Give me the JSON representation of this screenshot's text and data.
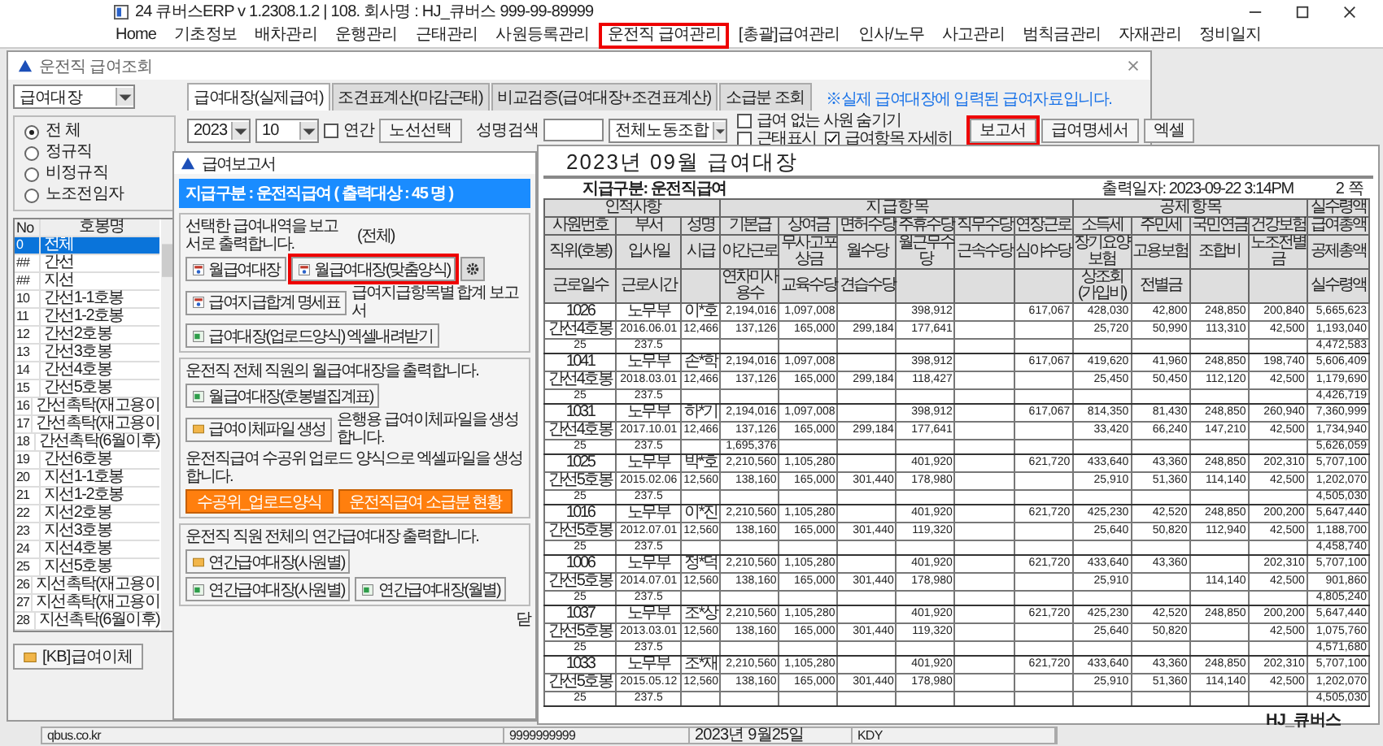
{
  "app_window": {
    "title": "24 큐버스ERP v 1.2308.1.2  | 108. 회사명 : HJ_큐버스  999-99-89999",
    "menu": [
      {
        "label": "Home",
        "highlighted": false
      },
      {
        "label": "기초정보",
        "highlighted": false
      },
      {
        "label": "배차관리",
        "highlighted": false
      },
      {
        "label": "운행관리",
        "highlighted": false
      },
      {
        "label": "근태관리",
        "highlighted": false
      },
      {
        "label": "사원등록관리",
        "highlighted": false
      },
      {
        "label": "운전직 급여관리",
        "highlighted": true
      },
      {
        "label": "[총괄]급여관리",
        "highlighted": false
      },
      {
        "label": "인사/노무",
        "highlighted": false
      },
      {
        "label": "사고관리",
        "highlighted": false
      },
      {
        "label": "범칙금관리",
        "highlighted": false
      },
      {
        "label": "자재관리",
        "highlighted": false
      },
      {
        "label": "정비일지",
        "highlighted": false
      }
    ]
  },
  "salary_window": {
    "title": "운전직 급여조회",
    "type_select": {
      "value": "급여대장"
    },
    "employment_filter": [
      {
        "label": "전 체",
        "selected": true
      },
      {
        "label": "정규직",
        "selected": false
      },
      {
        "label": "비정규직",
        "selected": false
      },
      {
        "label": "노조전임자",
        "selected": false
      }
    ],
    "grade_list": {
      "columns": [
        "No",
        "호봉명"
      ],
      "rows": [
        {
          "no": "0",
          "name": "전체",
          "selected": true
        },
        {
          "no": "##",
          "name": "간선",
          "selected": false
        },
        {
          "no": "##",
          "name": "지선",
          "selected": false
        },
        {
          "no": "10",
          "name": "간선1-1호봉",
          "selected": false
        },
        {
          "no": "11",
          "name": "간선1-2호봉",
          "selected": false
        },
        {
          "no": "12",
          "name": "간선2호봉",
          "selected": false
        },
        {
          "no": "13",
          "name": "간선3호봉",
          "selected": false
        },
        {
          "no": "14",
          "name": "간선4호봉",
          "selected": false
        },
        {
          "no": "15",
          "name": "간선5호봉",
          "selected": false
        },
        {
          "no": "16",
          "name": "간선촉탁(재고용이",
          "selected": false
        },
        {
          "no": "17",
          "name": "간선촉탁(재고용이",
          "selected": false
        },
        {
          "no": "18",
          "name": "간선촉탁(6월이후)",
          "selected": false
        },
        {
          "no": "19",
          "name": "간선6호봉",
          "selected": false
        },
        {
          "no": "20",
          "name": "지선1-1호봉",
          "selected": false
        },
        {
          "no": "21",
          "name": "지선1-2호봉",
          "selected": false
        },
        {
          "no": "22",
          "name": "지선2호봉",
          "selected": false
        },
        {
          "no": "23",
          "name": "지선3호봉",
          "selected": false
        },
        {
          "no": "24",
          "name": "지선4호봉",
          "selected": false
        },
        {
          "no": "25",
          "name": "지선5호봉",
          "selected": false
        },
        {
          "no": "26",
          "name": "지선촉탁(재고용이",
          "selected": false
        },
        {
          "no": "27",
          "name": "지선촉탁(재고용이",
          "selected": false
        },
        {
          "no": "28",
          "name": "지선촉탁(6월이후)",
          "selected": false
        }
      ]
    },
    "kb_button": "[KB]급여이체",
    "tabs": [
      {
        "label": "급여대장(실제급여)",
        "selected": true
      },
      {
        "label": "조견표계산(마감근태)",
        "selected": false
      },
      {
        "label": "비교검증(급여대장+조견표계산)",
        "selected": false
      },
      {
        "label": "소급분 조회",
        "selected": false
      }
    ],
    "notice": "※실제 급여대장에 입력된 급여자료입니다.",
    "year_select": {
      "value": "2023"
    },
    "month_select": {
      "value": "10"
    },
    "annual_checkbox": {
      "label": "연간",
      "checked": false
    },
    "route_button": "노선선택",
    "name_search_label": "성명검색",
    "union_select": {
      "value": "전체노동조합"
    },
    "options": [
      {
        "label": "급여 없는 사원 숨기기",
        "checked": false
      },
      {
        "label": "근태표시",
        "checked": false
      },
      {
        "label": "급여항목 자세히",
        "checked": true
      }
    ],
    "buttons": [
      {
        "label": "보고서",
        "highlighted": true
      },
      {
        "label": "급여명세서",
        "highlighted": false
      },
      {
        "label": "엑셀",
        "highlighted": false
      }
    ]
  },
  "report_dialog": {
    "title": "급여보고서",
    "banner": "지급구분 : 운전직급여 ( 출력대상 : 45 명 )",
    "sections": [
      {
        "rows": [
          [
            {
              "kind": "text",
              "text": "선택한 급여내역을 보고서로 출력합니다."
            },
            {
              "kind": "text",
              "text": "(전체)"
            }
          ],
          [
            {
              "kind": "button",
              "label": "월급여대장",
              "highlighted": false
            },
            {
              "kind": "button",
              "label": "월급여대장(맞춤양식)",
              "highlighted": true
            },
            {
              "kind": "gear"
            }
          ],
          [
            {
              "kind": "button",
              "label": "급여지급합계 명세표",
              "highlighted": false
            },
            {
              "kind": "text",
              "text": "급여지급항목별 합계 보고서"
            }
          ],
          [
            {
              "kind": "button",
              "label": "급여대장(업로드양식) 엑셀내려받기",
              "highlighted": false
            }
          ]
        ]
      },
      {
        "rows": [
          [
            {
              "kind": "text",
              "text": "운전직 전체 직원의 월급여대장을 출력합니다."
            }
          ],
          [
            {
              "kind": "button",
              "label": "월급여대장(호봉별집계표)",
              "highlighted": false
            }
          ],
          [
            {
              "kind": "button",
              "label": "급여이체파일 생성",
              "highlighted": false
            },
            {
              "kind": "text",
              "text": "은행용 급여이체파일을 생성합니다."
            }
          ],
          [
            {
              "kind": "text",
              "text": "운전직급여 수공위 업로드 양식으로 엑셀파일을 생성합니다."
            }
          ],
          [
            {
              "kind": "orange",
              "label": "수공위_업로드양식",
              "highlighted": false
            },
            {
              "kind": "orange",
              "label": "운전직급여 소급분 현황",
              "highlighted": false
            }
          ]
        ]
      },
      {
        "rows": [
          [
            {
              "kind": "text",
              "text": "운전직 직원 전체의 연간급여대장 출력합니다."
            }
          ],
          [
            {
              "kind": "button",
              "label": "연간급여대장(사원별)",
              "highlighted": false
            }
          ],
          [
            {
              "kind": "button",
              "label": "연간급여대장(사원별)",
              "highlighted": false
            },
            {
              "kind": "button",
              "label": "연간급여대장(월별)",
              "highlighted": false
            }
          ]
        ]
      }
    ],
    "close_label": "닫"
  },
  "report": {
    "title": "2023년 09월 급여대장",
    "pay_type": "지급구분:  운전직급여",
    "printed_at": "출력일자:  2023-09-22   3:14PM",
    "page": "2 쪽",
    "column_groups": [
      {
        "label": "인적사항",
        "columns": [
          [
            "사원번호",
            "직위(호봉)",
            "근로일수"
          ],
          [
            "부서",
            "입사일",
            "근로시간"
          ],
          [
            "성명",
            "시급",
            null
          ]
        ]
      },
      {
        "label": "지 급 항 목",
        "columns": [
          [
            "기본급",
            "야간근로",
            "연차미사용수"
          ],
          [
            "상여금",
            "무사고포상금",
            "교육수당"
          ],
          [
            "면허수당",
            "월수당",
            "견습수당"
          ],
          [
            "주휴수당",
            "월근무수당",
            null
          ],
          [
            "직무수당",
            "근속수당",
            null
          ],
          [
            "연장근로",
            "심야수당",
            null
          ]
        ]
      },
      {
        "label": "공 제 항 목",
        "columns": [
          [
            "소득세",
            "장기요양보험",
            "상조회(가입비)"
          ],
          [
            "주민세",
            "고용보험",
            "전별금"
          ],
          [
            "국민연금",
            "조합비",
            null
          ],
          [
            "건강보험",
            "노조전별금",
            null
          ]
        ]
      },
      {
        "label": "실수령액",
        "columns": [
          [
            "급여총액",
            "공제총액",
            "실수령액"
          ]
        ]
      }
    ],
    "employees": [
      {
        "rows": [
          [
            "1026",
            "노무부",
            "이*호",
            "2,194,016",
            "1,097,008",
            null,
            "398,912",
            null,
            "617,067",
            "428,030",
            "42,800",
            "248,850",
            "200,840",
            "5,665,623"
          ],
          [
            "간선4호봉",
            "2016.06.01",
            "12,466",
            "137,126",
            "165,000",
            "299,184",
            "177,641",
            null,
            null,
            "25,720",
            "50,990",
            "113,310",
            "42,500",
            "1,193,040"
          ],
          [
            "25",
            "237.5",
            null,
            null,
            null,
            null,
            null,
            null,
            null,
            null,
            null,
            null,
            null,
            "4,472,583"
          ]
        ]
      },
      {
        "rows": [
          [
            "1041",
            "노무부",
            "손*학",
            "2,194,016",
            "1,097,008",
            null,
            "398,912",
            null,
            "617,067",
            "419,620",
            "41,960",
            "248,850",
            "198,740",
            "5,606,409"
          ],
          [
            "간선4호봉",
            "2018.03.01",
            "12,466",
            "137,126",
            "165,000",
            "299,184",
            "118,427",
            null,
            null,
            "25,450",
            "50,450",
            "112,120",
            "42,500",
            "1,179,690"
          ],
          [
            "25",
            "237.5",
            null,
            null,
            null,
            null,
            null,
            null,
            null,
            null,
            null,
            null,
            null,
            "4,426,719"
          ]
        ]
      },
      {
        "rows": [
          [
            "1031",
            "노무부",
            "하*기",
            "2,194,016",
            "1,097,008",
            null,
            "398,912",
            null,
            "617,067",
            "814,350",
            "81,430",
            "248,850",
            "260,940",
            "7,360,999"
          ],
          [
            "간선4호봉",
            "2017.10.01",
            "12,466",
            "137,126",
            "165,000",
            "299,184",
            "177,641",
            null,
            null,
            "33,420",
            "66,240",
            "147,210",
            "42,500",
            "1,734,940"
          ],
          [
            "25",
            "237.5",
            null,
            "1,695,376",
            null,
            null,
            null,
            null,
            null,
            null,
            null,
            null,
            null,
            "5,626,059"
          ]
        ]
      },
      {
        "rows": [
          [
            "1025",
            "노무부",
            "박*호",
            "2,210,560",
            "1,105,280",
            null,
            "401,920",
            null,
            "621,720",
            "433,640",
            "43,360",
            "248,850",
            "202,310",
            "5,707,100"
          ],
          [
            "간선5호봉",
            "2015.02.06",
            "12,560",
            "138,160",
            "165,000",
            "301,440",
            "178,980",
            null,
            null,
            "25,910",
            "51,360",
            "114,140",
            "42,500",
            "1,202,070"
          ],
          [
            "25",
            "237.5",
            null,
            null,
            null,
            null,
            null,
            null,
            null,
            null,
            null,
            null,
            null,
            "4,505,030"
          ]
        ]
      },
      {
        "rows": [
          [
            "1016",
            "노무부",
            "이*진",
            "2,210,560",
            "1,105,280",
            null,
            "401,920",
            null,
            "621,720",
            "425,230",
            "42,520",
            "248,850",
            "200,200",
            "5,647,440"
          ],
          [
            "간선5호봉",
            "2012.07.01",
            "12,560",
            "138,160",
            "165,000",
            "301,440",
            "119,320",
            null,
            null,
            "25,640",
            "50,820",
            "112,940",
            "42,500",
            "1,188,700"
          ],
          [
            "25",
            "237.5",
            null,
            null,
            null,
            null,
            null,
            null,
            null,
            null,
            null,
            null,
            null,
            "4,458,740"
          ]
        ]
      },
      {
        "rows": [
          [
            "1006",
            "노무부",
            "정*덕",
            "2,210,560",
            "1,105,280",
            null,
            "401,920",
            null,
            "621,720",
            "433,640",
            "43,360",
            null,
            "202,310",
            "5,707,100"
          ],
          [
            "간선5호봉",
            "2014.07.01",
            "12,560",
            "138,160",
            "165,000",
            "301,440",
            "178,980",
            null,
            null,
            "25,910",
            null,
            "114,140",
            "42,500",
            "901,860"
          ],
          [
            "25",
            "237.5",
            null,
            null,
            null,
            null,
            null,
            null,
            null,
            null,
            null,
            null,
            null,
            "4,805,240"
          ]
        ]
      },
      {
        "rows": [
          [
            "1037",
            "노무부",
            "조*상",
            "2,210,560",
            "1,105,280",
            null,
            "401,920",
            null,
            "621,720",
            "425,230",
            "42,520",
            "248,850",
            "200,200",
            "5,647,440"
          ],
          [
            "간선5호봉",
            "2013.03.01",
            "12,560",
            "138,160",
            "165,000",
            "301,440",
            "119,320",
            null,
            null,
            "25,640",
            "50,820",
            null,
            "42,500",
            "1,075,760"
          ],
          [
            "25",
            "237.5",
            null,
            null,
            null,
            null,
            null,
            null,
            null,
            null,
            null,
            null,
            null,
            "4,571,680"
          ]
        ]
      },
      {
        "rows": [
          [
            "1033",
            "노무부",
            "조*재",
            "2,210,560",
            "1,105,280",
            null,
            "401,920",
            null,
            "621,720",
            "433,640",
            "43,360",
            "248,850",
            "202,310",
            "5,707,100"
          ],
          [
            "간선5호봉",
            "2015.05.12",
            "12,560",
            "138,160",
            "165,000",
            "301,440",
            "178,980",
            null,
            null,
            "25,910",
            "51,360",
            "114,140",
            "42,500",
            "1,202,070"
          ],
          [
            "25",
            "237.5",
            null,
            null,
            null,
            null,
            null,
            null,
            null,
            null,
            null,
            null,
            null,
            "4,505,030"
          ]
        ]
      }
    ],
    "footer": "HJ_큐버스"
  },
  "status_bar": [
    "qbus.co.kr",
    "9999999999",
    "2023년 9월25일",
    "KDY"
  ]
}
